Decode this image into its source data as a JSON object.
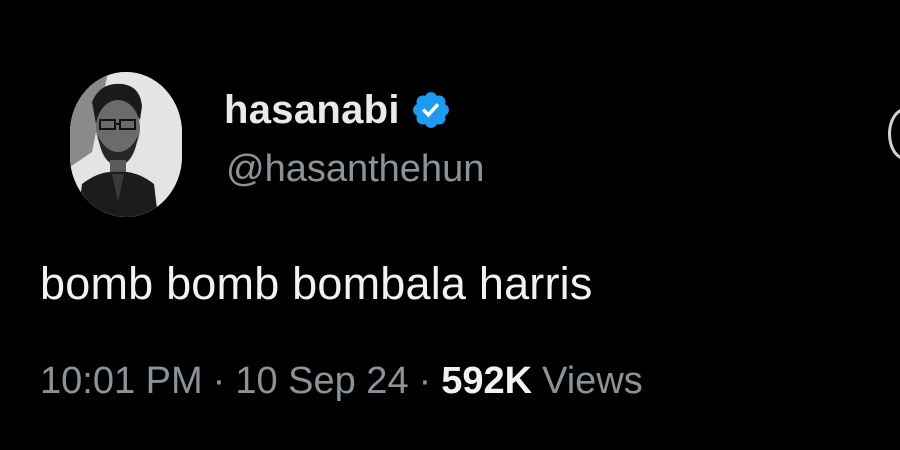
{
  "author": {
    "display_name": "hasanabi",
    "handle": "@hasanthehun",
    "verified": true,
    "verified_color": "#1d9bf0"
  },
  "tweet": {
    "text": "bomb bomb bombala harris"
  },
  "meta": {
    "time": "10:01 PM",
    "separator": "·",
    "date": "10 Sep 24",
    "views_count": "592K",
    "views_label": "Views"
  }
}
